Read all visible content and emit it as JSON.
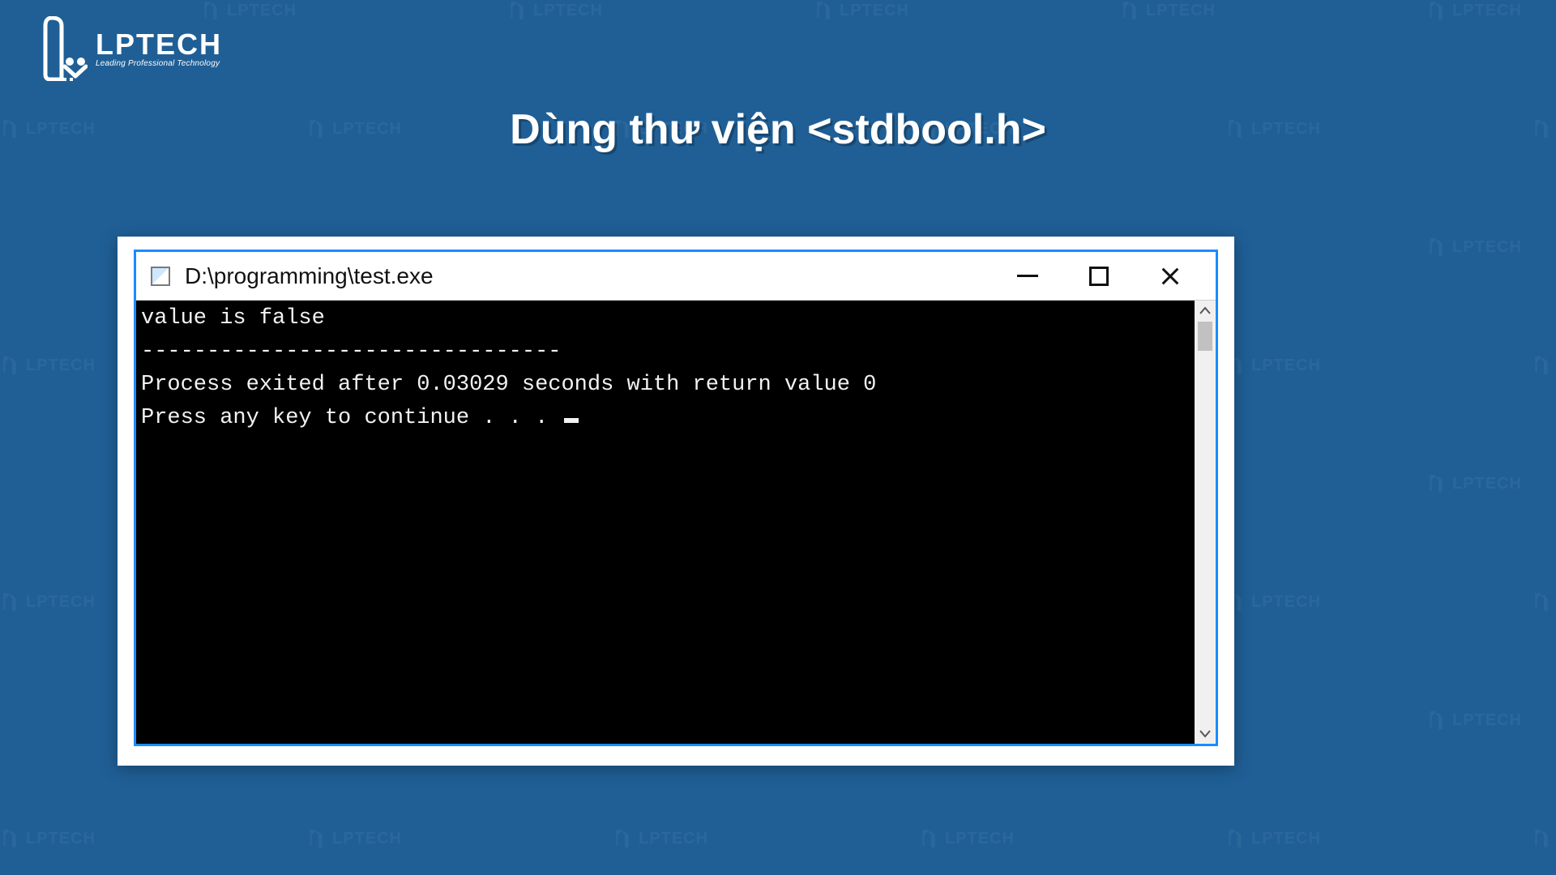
{
  "logo": {
    "brand": "LPTECH",
    "tagline": "Leading Professional Technology"
  },
  "headline": "Dùng thư viện <stdbool.h>",
  "window": {
    "path": "D:\\programming\\test.exe"
  },
  "console": {
    "line1": "value is false",
    "line2": "--------------------------------",
    "line3": "Process exited after 0.03029 seconds with return value 0",
    "line4": "Press any key to continue . . . "
  },
  "watermark_text": "LPTECH"
}
